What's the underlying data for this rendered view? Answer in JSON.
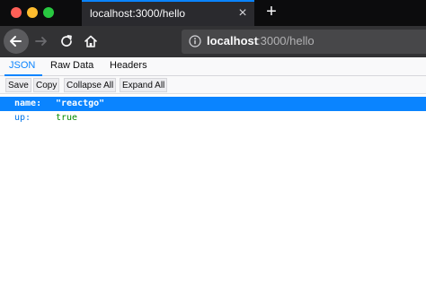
{
  "window": {
    "controls": [
      "close",
      "minimize",
      "maximize"
    ],
    "colors": {
      "close": "#fe5f57",
      "minimize": "#febc2e",
      "maximize": "#28c840"
    }
  },
  "tab": {
    "title": "localhost:3000/hello",
    "close_icon": "close-icon"
  },
  "new_tab_icon": "plus-icon",
  "nav": {
    "back_icon": "back-arrow-icon",
    "forward_icon": "forward-arrow-icon",
    "reload_icon": "reload-icon",
    "home_icon": "home-icon"
  },
  "urlbar": {
    "info_icon": "info-icon",
    "host": "localhost",
    "rest": ":3000/hello"
  },
  "viewer": {
    "tabs": [
      "JSON",
      "Raw Data",
      "Headers"
    ],
    "active_tab": "JSON",
    "accent": "#0a84ff"
  },
  "toolbar": {
    "save_label": "Save",
    "copy_label": "Copy",
    "collapse_label": "Collapse All",
    "expand_label": "Expand All"
  },
  "json_rows": [
    {
      "key": "name:",
      "value": "\"reactgo\"",
      "selected": true
    },
    {
      "key": "up:",
      "value": "true",
      "selected": false
    }
  ]
}
